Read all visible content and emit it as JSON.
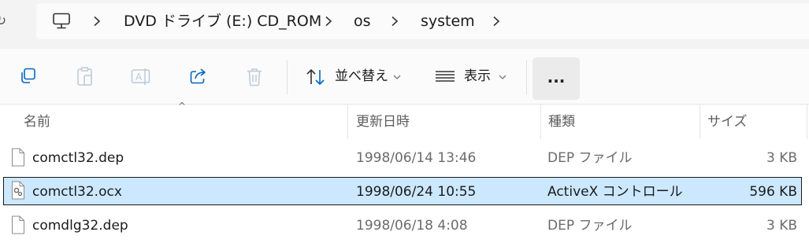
{
  "address_bar": {
    "breadcrumbs": [
      "DVD ドライブ (E:) CD_ROM",
      "os",
      "system"
    ]
  },
  "toolbar": {
    "sort_label": "並べ替え",
    "view_label": "表示",
    "more_label": "..."
  },
  "columns": {
    "name": "名前",
    "date": "更新日時",
    "type": "種類",
    "size": "サイズ"
  },
  "files": [
    {
      "name": "comctl32.dep",
      "date": "1998/06/14 13:46",
      "type": "DEP ファイル",
      "size": "3 KB",
      "selected": false,
      "icon": "file-icon"
    },
    {
      "name": "comctl32.ocx",
      "date": "1998/06/24 10:55",
      "type": "ActiveX コントロール",
      "size": "596 KB",
      "selected": true,
      "icon": "activex-file-icon"
    },
    {
      "name": "comdlg32.dep",
      "date": "1998/06/18 4:08",
      "type": "DEP ファイル",
      "size": "3 KB",
      "selected": false,
      "icon": "file-icon"
    }
  ],
  "colors": {
    "selection_bg": "#cce8ff",
    "selection_border": "#1a1a1a",
    "accent": "#0067c0"
  }
}
